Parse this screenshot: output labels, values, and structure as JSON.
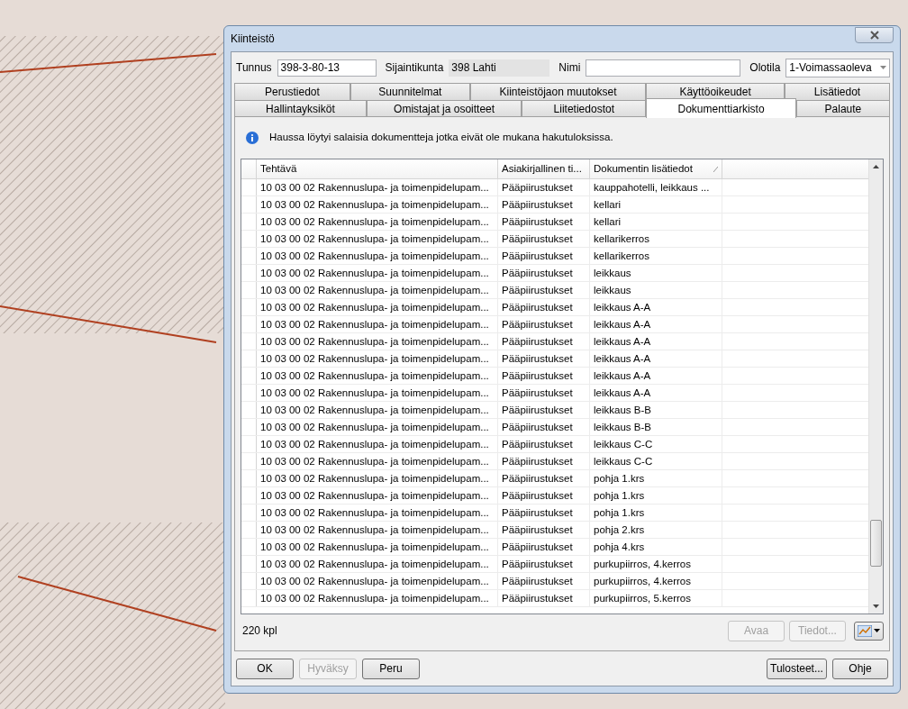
{
  "window": {
    "title": "Kiinteistö"
  },
  "fields": [
    {
      "label": "Tunnus",
      "value": "398-3-80-13",
      "kind": "input"
    },
    {
      "label": "Sijaintikunta",
      "value": "398 Lahti",
      "kind": "readonly"
    },
    {
      "label": "Nimi",
      "kind": "input"
    },
    {
      "label": "Olotila",
      "value": "1-Voimassaoleva",
      "kind": "select"
    }
  ],
  "tab_rows": [
    [
      {
        "label": "Perustiedot",
        "selected": false
      },
      {
        "label": "Suunnitelmat",
        "selected": false
      },
      {
        "label": "Kiinteistöjaon muutokset",
        "selected": false
      },
      {
        "label": "Käyttöoikeudet",
        "selected": false
      },
      {
        "label": "Lisätiedot",
        "selected": false
      }
    ],
    [
      {
        "label": "Hallintayksiköt",
        "selected": false
      },
      {
        "label": "Omistajat ja osoitteet",
        "selected": false
      },
      {
        "label": "Liitetiedostot",
        "selected": false
      },
      {
        "label": "Dokumenttiarkisto",
        "selected": true
      },
      {
        "label": "Palaute",
        "selected": false
      }
    ]
  ],
  "info_message": "Haussa löytyi salaisia dokumentteja jotka eivät ole mukana hakutuloksissa.",
  "table": {
    "columns": [
      "Tehtävä",
      "Asiakirjallinen ti...",
      "Dokumentin lisätiedot"
    ],
    "rows": [
      [
        "10 03 00 02 Rakennuslupa- ja toimenpidelupam...",
        "Pääpiirustukset",
        "kauppahotelli, leikkaus ..."
      ],
      [
        "10 03 00 02 Rakennuslupa- ja toimenpidelupam...",
        "Pääpiirustukset",
        "kellari"
      ],
      [
        "10 03 00 02 Rakennuslupa- ja toimenpidelupam...",
        "Pääpiirustukset",
        "kellari"
      ],
      [
        "10 03 00 02 Rakennuslupa- ja toimenpidelupam...",
        "Pääpiirustukset",
        "kellarikerros"
      ],
      [
        "10 03 00 02 Rakennuslupa- ja toimenpidelupam...",
        "Pääpiirustukset",
        "kellarikerros"
      ],
      [
        "10 03 00 02 Rakennuslupa- ja toimenpidelupam...",
        "Pääpiirustukset",
        "leikkaus"
      ],
      [
        "10 03 00 02 Rakennuslupa- ja toimenpidelupam...",
        "Pääpiirustukset",
        "leikkaus"
      ],
      [
        "10 03 00 02 Rakennuslupa- ja toimenpidelupam...",
        "Pääpiirustukset",
        "leikkaus A-A"
      ],
      [
        "10 03 00 02 Rakennuslupa- ja toimenpidelupam...",
        "Pääpiirustukset",
        "leikkaus A-A"
      ],
      [
        "10 03 00 02 Rakennuslupa- ja toimenpidelupam...",
        "Pääpiirustukset",
        "leikkaus A-A"
      ],
      [
        "10 03 00 02 Rakennuslupa- ja toimenpidelupam...",
        "Pääpiirustukset",
        "leikkaus A-A"
      ],
      [
        "10 03 00 02 Rakennuslupa- ja toimenpidelupam...",
        "Pääpiirustukset",
        "leikkaus A-A"
      ],
      [
        "10 03 00 02 Rakennuslupa- ja toimenpidelupam...",
        "Pääpiirustukset",
        "leikkaus A-A"
      ],
      [
        "10 03 00 02 Rakennuslupa- ja toimenpidelupam...",
        "Pääpiirustukset",
        "leikkaus B-B"
      ],
      [
        "10 03 00 02 Rakennuslupa- ja toimenpidelupam...",
        "Pääpiirustukset",
        "leikkaus B-B"
      ],
      [
        "10 03 00 02 Rakennuslupa- ja toimenpidelupam...",
        "Pääpiirustukset",
        "leikkaus C-C"
      ],
      [
        "10 03 00 02 Rakennuslupa- ja toimenpidelupam...",
        "Pääpiirustukset",
        "leikkaus C-C"
      ],
      [
        "10 03 00 02 Rakennuslupa- ja toimenpidelupam...",
        "Pääpiirustukset",
        "pohja 1.krs"
      ],
      [
        "10 03 00 02 Rakennuslupa- ja toimenpidelupam...",
        "Pääpiirustukset",
        "pohja 1.krs"
      ],
      [
        "10 03 00 02 Rakennuslupa- ja toimenpidelupam...",
        "Pääpiirustukset",
        "pohja 1.krs"
      ],
      [
        "10 03 00 02 Rakennuslupa- ja toimenpidelupam...",
        "Pääpiirustukset",
        "pohja 2.krs"
      ],
      [
        "10 03 00 02 Rakennuslupa- ja toimenpidelupam...",
        "Pääpiirustukset",
        "pohja 4.krs"
      ],
      [
        "10 03 00 02 Rakennuslupa- ja toimenpidelupam...",
        "Pääpiirustukset",
        "purkupiirros, 4.kerros"
      ],
      [
        "10 03 00 02 Rakennuslupa- ja toimenpidelupam...",
        "Pääpiirustukset",
        "purkupiirros, 4.kerros"
      ],
      [
        "10 03 00 02 Rakennuslupa- ja toimenpidelupam...",
        "Pääpiirustukset",
        "purkupiirros, 5.kerros"
      ]
    ]
  },
  "count": "220 kpl",
  "list_buttons": [
    {
      "label": "Avaa",
      "disabled": true
    },
    {
      "label": "Tiedot...",
      "disabled": true
    }
  ],
  "footer_left": [
    {
      "label": "OK",
      "disabled": false
    },
    {
      "label": "Hyväksy",
      "disabled": true
    },
    {
      "label": "Peru",
      "disabled": false
    }
  ],
  "footer_right": [
    {
      "label": "Tulosteet...",
      "disabled": false
    },
    {
      "label": "Ohje",
      "disabled": false
    }
  ]
}
